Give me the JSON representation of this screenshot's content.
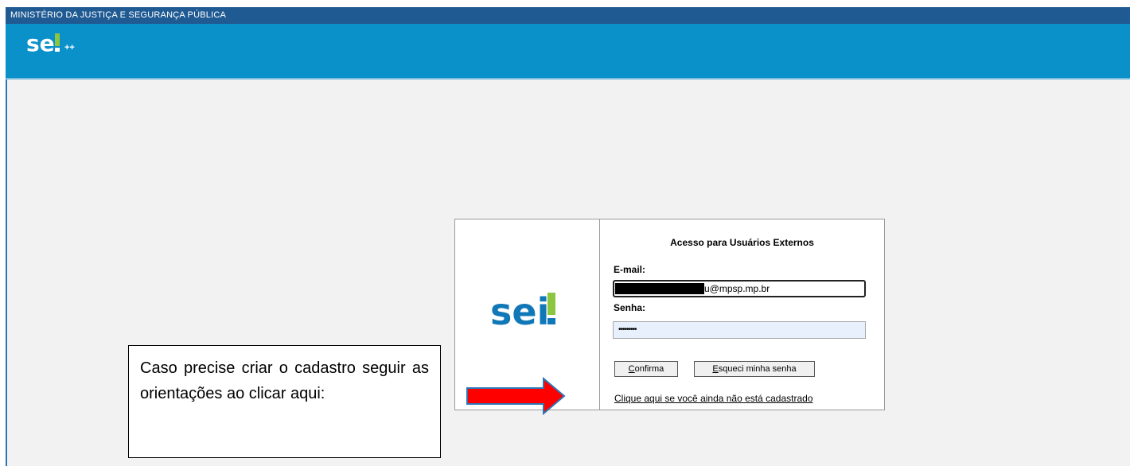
{
  "gov_bar": {
    "text": "MINISTÉRIO DA JUSTIÇA E SEGURANÇA PÚBLICA"
  },
  "header": {
    "logo": "sei",
    "logo_suffix": "++"
  },
  "login": {
    "title": "Acesso para Usuários Externos",
    "email_label": "E-mail:",
    "email_value": "u@mpsp.mp.br",
    "password_label": "Senha:",
    "password_value": "•••••••••",
    "confirm_button": "onfirma",
    "confirm_button_accel": "C",
    "forgot_button": "squeci minha senha",
    "forgot_button_accel": "E",
    "register_link": "Clique aqui se você ainda não está cadastrado",
    "logo": "sei"
  },
  "callout": {
    "text": "Caso precise criar o cadastro seguir as orientações ao clicar aqui:"
  },
  "colors": {
    "gov_bar": "#1f5a93",
    "header": "#0b91c9",
    "logo_green": "#8cc63f",
    "arrow": "#ff0000",
    "arrow_border": "#2e75b6"
  },
  "icons": {
    "arrow": "right-arrow-icon"
  }
}
